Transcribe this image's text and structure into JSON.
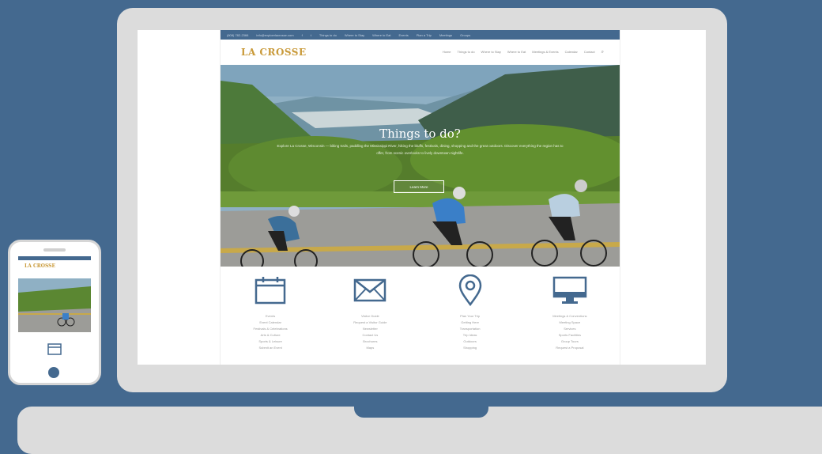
{
  "site": {
    "topbar": [
      "(608) 782-2366",
      "info@explorelacrosse.com",
      "f",
      "t",
      "Things to do",
      "Where to Stay",
      "Where to Eat",
      "Events",
      "Plan a Trip",
      "Meetings",
      "Groups"
    ],
    "logo": "LA CROSSE",
    "nav": [
      "Home",
      "Things to do",
      "Where to Stay",
      "Where to Eat",
      "Meetings & Events",
      "Calendar",
      "Contact"
    ],
    "hero": {
      "title": "Things to do?",
      "text": "Explore La Crosse, Wisconsin — biking trails, paddling the Mississippi River, hiking the bluffs, festivals, dining, shopping and the great outdoors. Discover everything the region has to offer, from scenic overlooks to lively downtown nightlife.",
      "button": "Learn More"
    },
    "features": [
      {
        "icon": "calendar-icon",
        "lines": [
          "Events",
          "Event Calendar",
          "Festivals & Celebrations",
          "Arts & Culture",
          "Sports & Leisure",
          "Submit an Event"
        ]
      },
      {
        "icon": "envelope-icon",
        "lines": [
          "Visitor Guide",
          "Request a Visitor Guide",
          "Newsletter",
          "Contact Us",
          "Brochures",
          "Maps"
        ]
      },
      {
        "icon": "map-pin-icon",
        "lines": [
          "Plan Your Trip",
          "Getting Here",
          "Transportation",
          "Trip Ideas",
          "Outdoors",
          "Shopping"
        ]
      },
      {
        "icon": "monitor-icon",
        "lines": [
          "Meetings & Conventions",
          "Meeting Space",
          "Services",
          "Sports Facilities",
          "Group Tours",
          "Request a Proposal"
        ]
      }
    ]
  },
  "phone": {
    "logo": "LA CROSSE"
  },
  "colors": {
    "background": "#44698f",
    "device": "#dcdcdc",
    "accent": "#c99a3a",
    "brand": "#44698f"
  }
}
